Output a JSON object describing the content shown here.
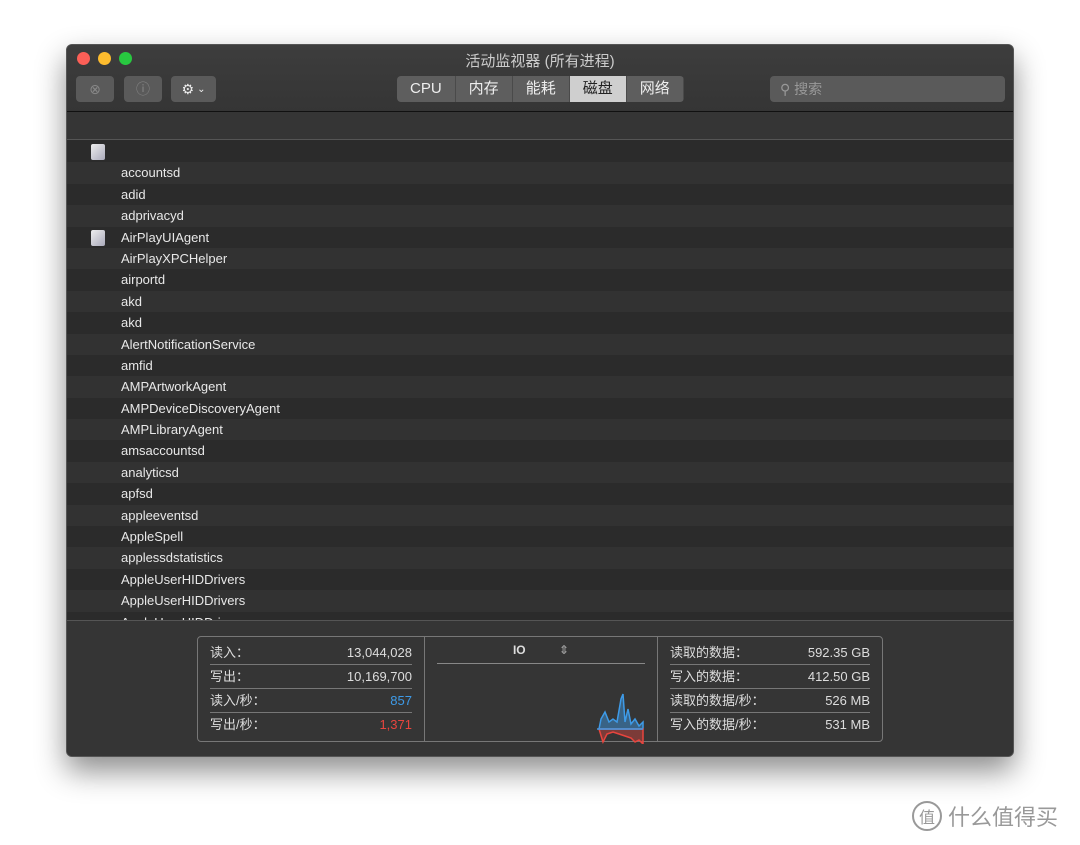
{
  "window": {
    "title": "活动监视器 (所有进程)"
  },
  "toolbar": {
    "stop_icon": "x-circle-icon",
    "info_icon": "info-icon",
    "gear_icon": "gear-icon",
    "tabs": [
      {
        "label": "CPU"
      },
      {
        "label": "内存"
      },
      {
        "label": "能耗"
      },
      {
        "label": "磁盘",
        "active": true
      },
      {
        "label": "网络"
      }
    ],
    "search_placeholder": "搜索"
  },
  "processes": [
    {
      "name": "",
      "icon": true
    },
    {
      "name": "accountsd"
    },
    {
      "name": "adid"
    },
    {
      "name": "adprivacyd"
    },
    {
      "name": "AirPlayUIAgent",
      "icon": true
    },
    {
      "name": "AirPlayXPCHelper"
    },
    {
      "name": "airportd"
    },
    {
      "name": "akd"
    },
    {
      "name": "akd"
    },
    {
      "name": "AlertNotificationService"
    },
    {
      "name": "amfid"
    },
    {
      "name": "AMPArtworkAgent"
    },
    {
      "name": "AMPDeviceDiscoveryAgent"
    },
    {
      "name": "AMPLibraryAgent"
    },
    {
      "name": "amsaccountsd"
    },
    {
      "name": "analyticsd"
    },
    {
      "name": "apfsd"
    },
    {
      "name": "appleeventsd"
    },
    {
      "name": "AppleSpell"
    },
    {
      "name": "applessdstatistics"
    },
    {
      "name": "AppleUserHIDDrivers"
    },
    {
      "name": "AppleUserHIDDrivers"
    },
    {
      "name": "AppleUserHIDDrivers"
    }
  ],
  "stats_left": [
    {
      "label": "读入：",
      "value": "13,044,028"
    },
    {
      "label": "写出：",
      "value": "10,169,700"
    },
    {
      "label": "读入/秒：",
      "value": "857",
      "color": "#3e9be8"
    },
    {
      "label": "写出/秒：",
      "value": "1,371",
      "color": "#e8453e"
    }
  ],
  "graph": {
    "label": "IO",
    "read_color": "#3e9be8",
    "write_color": "#e8453e"
  },
  "stats_right": [
    {
      "label": "读取的数据：",
      "value": "592.35 GB"
    },
    {
      "label": "写入的数据：",
      "value": "412.50 GB"
    },
    {
      "label": "读取的数据/秒：",
      "value": "526 MB"
    },
    {
      "label": "写入的数据/秒：",
      "value": "531 MB"
    }
  ],
  "watermark": {
    "text": "什么值得买",
    "logo": "值"
  }
}
